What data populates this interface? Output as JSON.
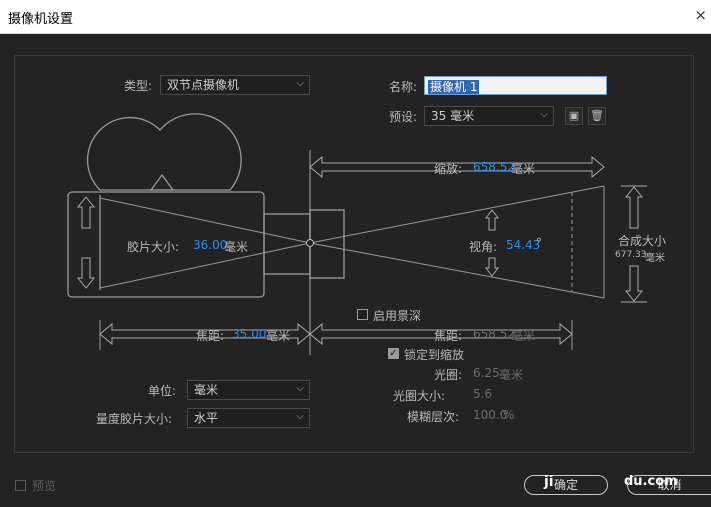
{
  "window": {
    "title": "摄像机设置",
    "close": "×"
  },
  "type": {
    "label": "类型:",
    "value": "双节点摄像机"
  },
  "name": {
    "label": "名称:",
    "value": "摄像机 1"
  },
  "preset": {
    "label": "预设:",
    "value": "35 毫米"
  },
  "zoom": {
    "label": "缩放:",
    "value": "658.52",
    "unit": "毫米"
  },
  "film_size": {
    "label": "胶片大小:",
    "value": "36.00",
    "unit": "毫米"
  },
  "view_angle": {
    "label": "视角:",
    "value": "54.43",
    "unit": "°"
  },
  "comp_size": {
    "label": "合成大小",
    "value": "677.33",
    "unit": "毫米"
  },
  "depth_of_field": {
    "label": "启用景深",
    "checked": false
  },
  "focal_length": {
    "label": "焦距:",
    "value": "35.00",
    "unit": "毫米"
  },
  "focus_distance": {
    "label": "焦距:",
    "value": "658.52",
    "unit": "毫米"
  },
  "lock_to_zoom": {
    "label": "锁定到缩放",
    "checked": true
  },
  "aperture": {
    "label": "光圈:",
    "value": "6.25",
    "unit": "毫米"
  },
  "f_stop": {
    "label": "光圈大小:",
    "value": "5.6"
  },
  "blur_level": {
    "label": "模糊层次:",
    "value": "100.0",
    "unit": "%"
  },
  "units": {
    "label": "单位:",
    "value": "毫米"
  },
  "measure_film": {
    "label": "量度胶片大小:",
    "value": "水平"
  },
  "preview": {
    "label": "预览",
    "checked": false
  },
  "buttons": {
    "ok": "确定",
    "cancel": "取消"
  },
  "watermark": {
    "left": "ji",
    "right": "du.com"
  },
  "colors": {
    "accent": "#2d8ceb",
    "background": "#232323",
    "line": "#9a9a9a"
  }
}
